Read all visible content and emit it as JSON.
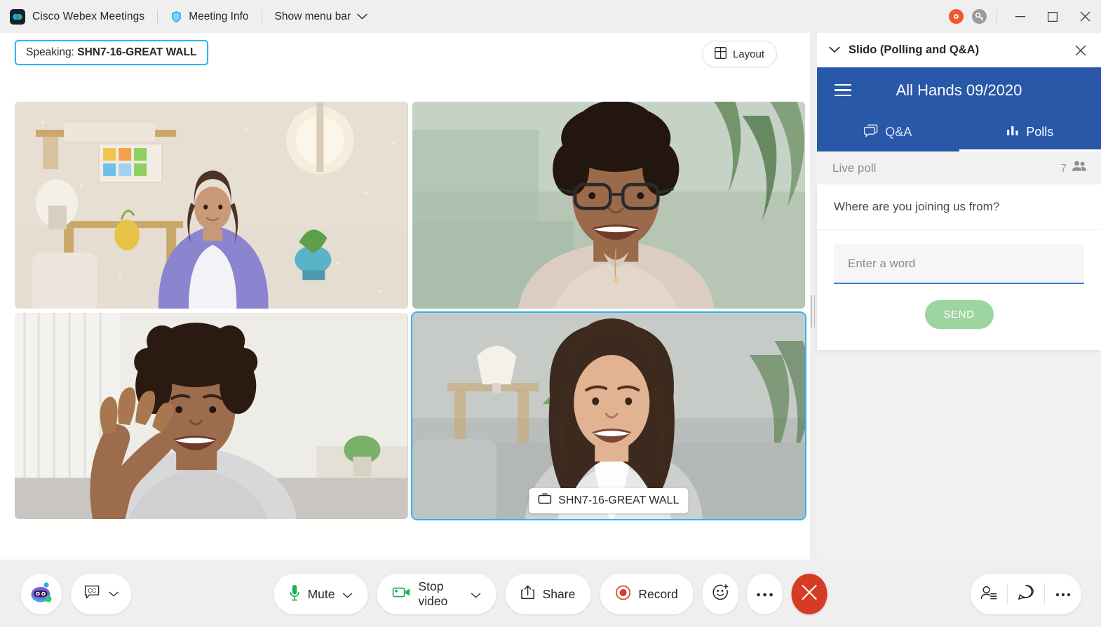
{
  "window": {
    "app_title": "Cisco Webex Meetings",
    "logo_icon": "webex-logo-icon",
    "meeting_info": {
      "label": "Meeting Info",
      "icon": "shield-icon"
    },
    "menu_bar": {
      "label": "Show menu bar",
      "icon": "chevron-down-icon"
    },
    "recording_indicator": {
      "icon": "record-indicator-icon",
      "color": "#f2552c"
    },
    "connection_badge": {
      "icon": "key-icon",
      "color": "#9b9b9b"
    },
    "minimize": "minimize-button",
    "maximize": "maximize-button",
    "close": "close-button"
  },
  "stage": {
    "speaking": {
      "prefix": "Speaking:",
      "name": "SHN7-16-GREAT WALL",
      "border_color": "#29b6f6"
    },
    "layout_button": {
      "label": "Layout",
      "icon": "grid-layout-icon"
    },
    "active_speaker_badge": {
      "name": "SHN7-16-GREAT WALL",
      "icon": "device-icon"
    },
    "tiles": [
      {
        "id": "tile-1",
        "participant": "participant-video-1",
        "active": false
      },
      {
        "id": "tile-2",
        "participant": "participant-video-2",
        "active": false
      },
      {
        "id": "tile-3",
        "participant": "participant-video-3",
        "active": false
      },
      {
        "id": "tile-4",
        "participant": "participant-video-4",
        "active": true
      }
    ],
    "resize_handle": "panel-resize-handle"
  },
  "toolbar": {
    "assistant": {
      "icon": "assistant-robot-icon"
    },
    "captions": {
      "icon": "closed-captions-icon",
      "chevron": "chevron-down-icon"
    },
    "mute": {
      "label": "Mute",
      "icon": "microphone-icon",
      "icon_color": "#1ab35a",
      "chevron": "chevron-down-icon"
    },
    "video": {
      "label": "Stop video",
      "icon": "camera-icon",
      "icon_color": "#1ab35a",
      "chevron": "chevron-down-icon"
    },
    "share": {
      "label": "Share",
      "icon": "share-upload-icon"
    },
    "record": {
      "label": "Record",
      "icon": "record-circle-icon",
      "icon_color": "#d63b24"
    },
    "reactions": {
      "icon": "smiley-plus-icon"
    },
    "more": {
      "icon": "more-horizontal-icon"
    },
    "end_call": {
      "icon": "end-call-x-icon",
      "color": "#d63b24"
    },
    "participants": {
      "icon": "participants-icon"
    },
    "chat": {
      "icon": "chat-bubble-icon"
    },
    "more_right": {
      "icon": "more-horizontal-icon"
    }
  },
  "slido": {
    "panel_title": "Slido (Polling and Q&A)",
    "collapse_icon": "chevron-down-icon",
    "close_icon": "close-icon",
    "menu_icon": "hamburger-menu-icon",
    "event_title": "All Hands 09/2020",
    "brand_color": "#2a58a8",
    "tabs": [
      {
        "label": "Q&A",
        "icon": "qa-bubble-icon",
        "active": false
      },
      {
        "label": "Polls",
        "icon": "poll-bars-icon",
        "active": true
      }
    ],
    "live_poll_label": "Live poll",
    "participant_count": "7",
    "participant_icon": "people-icon",
    "question": "Where are you joining us from?",
    "input_placeholder": "Enter a word",
    "input_value": "",
    "send_label": "SEND",
    "send_color": "#9ed4a0"
  }
}
